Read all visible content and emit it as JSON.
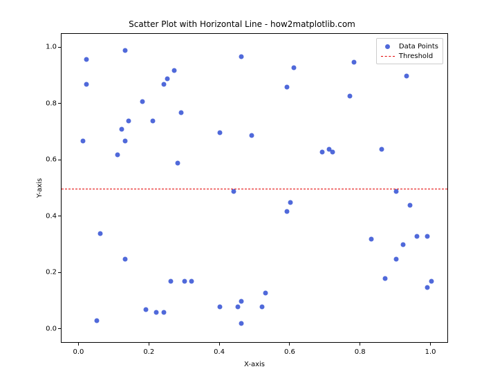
{
  "chart_data": {
    "type": "scatter",
    "title": "Scatter Plot with Horizontal Line - how2matplotlib.com",
    "xlabel": "X-axis",
    "ylabel": "Y-axis",
    "xlim": [
      -0.05,
      1.05
    ],
    "ylim": [
      -0.05,
      1.05
    ],
    "xticks": [
      0.0,
      0.2,
      0.4,
      0.6,
      0.8,
      1.0
    ],
    "yticks": [
      0.0,
      0.2,
      0.4,
      0.6,
      0.8,
      1.0
    ],
    "threshold": 0.5,
    "series": [
      {
        "name": "Data Points",
        "x": [
          0.01,
          0.02,
          0.02,
          0.05,
          0.06,
          0.11,
          0.12,
          0.13,
          0.13,
          0.13,
          0.14,
          0.18,
          0.19,
          0.21,
          0.22,
          0.24,
          0.24,
          0.25,
          0.26,
          0.27,
          0.28,
          0.29,
          0.3,
          0.32,
          0.4,
          0.4,
          0.44,
          0.45,
          0.46,
          0.46,
          0.46,
          0.49,
          0.52,
          0.53,
          0.59,
          0.59,
          0.6,
          0.61,
          0.69,
          0.71,
          0.72,
          0.77,
          0.78,
          0.83,
          0.86,
          0.87,
          0.9,
          0.9,
          0.92,
          0.93,
          0.94,
          0.96,
          0.99,
          0.99,
          1.0
        ],
        "y": [
          0.67,
          0.87,
          0.96,
          0.03,
          0.34,
          0.62,
          0.71,
          0.67,
          0.99,
          0.25,
          0.74,
          0.81,
          0.07,
          0.74,
          0.06,
          0.06,
          0.87,
          0.89,
          0.17,
          0.92,
          0.59,
          0.77,
          0.17,
          0.17,
          0.08,
          0.7,
          0.49,
          0.08,
          0.1,
          0.02,
          0.97,
          0.69,
          0.08,
          0.13,
          0.42,
          0.86,
          0.45,
          0.93,
          0.63,
          0.64,
          0.63,
          0.83,
          0.95,
          0.32,
          0.64,
          0.18,
          0.25,
          0.49,
          0.3,
          0.9,
          0.44,
          0.33,
          0.33,
          0.15,
          0.17
        ]
      }
    ],
    "legend": {
      "pos": "upper right",
      "items": [
        "Data Points",
        "Threshold"
      ]
    }
  }
}
